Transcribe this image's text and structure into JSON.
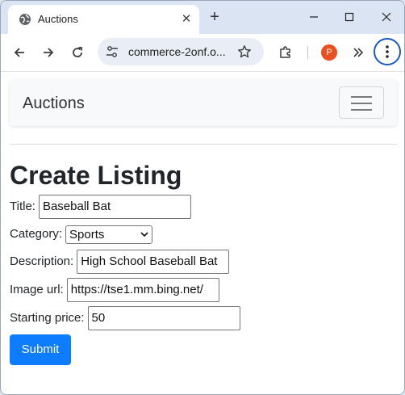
{
  "browser": {
    "tab_title": "Auctions",
    "new_tab_label": "+",
    "url": "commerce-2onf.o...",
    "profile_initial": "P"
  },
  "navbar": {
    "brand": "Auctions"
  },
  "form": {
    "heading": "Create Listing",
    "title_label": "Title:",
    "title_value": "Baseball Bat",
    "category_label": "Category:",
    "category_value": "Sports",
    "description_label": "Description:",
    "description_value": "High School Baseball Bat",
    "image_label": "Image url:",
    "image_value": "https://tse1.mm.bing.net/",
    "price_label": "Starting price:",
    "price_value": "50",
    "submit_label": "Submit"
  },
  "colors": {
    "primary": "#0d7cff",
    "profile": "#e8501f",
    "focus_ring": "#1a58c8"
  }
}
